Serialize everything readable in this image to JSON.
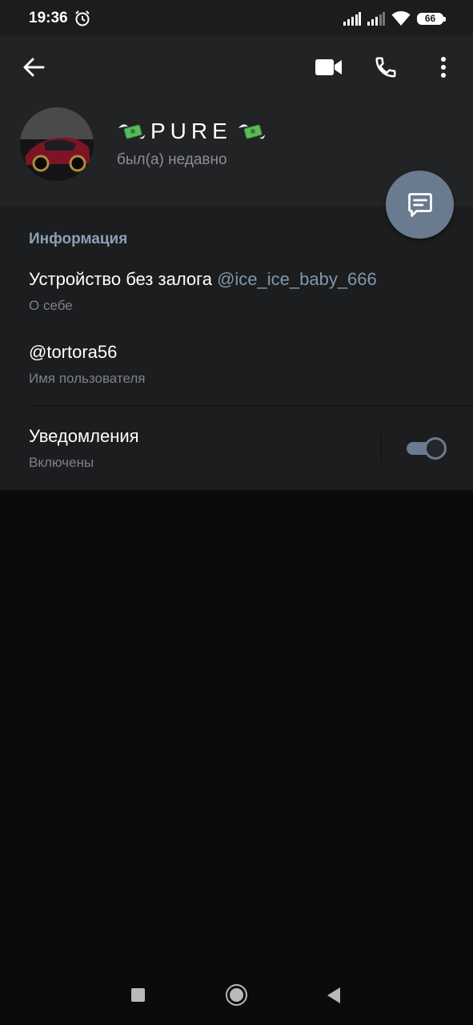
{
  "status_bar": {
    "time": "19:36",
    "battery": "66",
    "icons": [
      "alarm-icon",
      "signal-icon",
      "signal-icon",
      "wifi-icon",
      "battery-icon"
    ]
  },
  "toolbar": {
    "icons": [
      "back-arrow-icon",
      "video-call-icon",
      "phone-icon",
      "more-vertical-icon"
    ]
  },
  "profile": {
    "name": "PURE",
    "status": "был(а) недавно",
    "name_decoration_icon": "money-with-wings-icon"
  },
  "fab": {
    "icon": "message-icon"
  },
  "info": {
    "section_title": "Информация",
    "bio": {
      "text": "Устройство без залога",
      "link": "@ice_ice_baby_666",
      "label": "О себе"
    },
    "username": {
      "value": "@tortora56",
      "label": "Имя пользователя"
    },
    "notifications": {
      "title": "Уведомления",
      "state": "Включены",
      "enabled": true
    }
  },
  "nav_bar": {
    "icons": [
      "recent-apps-icon",
      "home-icon",
      "back-icon"
    ]
  },
  "colors": {
    "accent": "#6a7b8f",
    "section_title": "#8aa0b6",
    "link": "#7f97ad",
    "header_bg": "#222325",
    "info_bg": "#1c1d1f",
    "page_bg": "#0b0b0c"
  }
}
